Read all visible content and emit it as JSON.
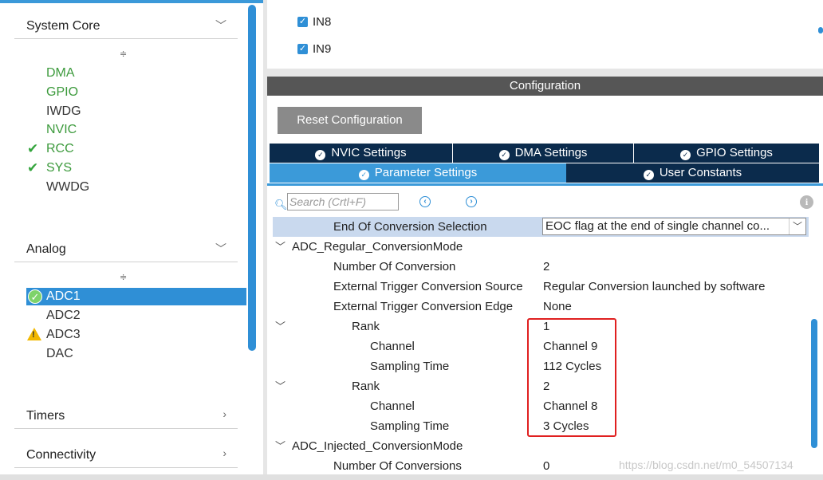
{
  "sidebar": {
    "categories": {
      "system_core": "System Core",
      "analog": "Analog",
      "timers": "Timers",
      "connectivity": "Connectivity"
    },
    "system_core_items": [
      "DMA",
      "GPIO",
      "IWDG",
      "NVIC",
      "RCC",
      "SYS",
      "WWDG"
    ],
    "analog_items": [
      "ADC1",
      "ADC2",
      "ADC3",
      "DAC"
    ]
  },
  "channels": {
    "in8": "IN8",
    "in9": "IN9"
  },
  "config": {
    "title": "Configuration",
    "reset_button": "Reset Configuration",
    "tabs": {
      "nvic": "NVIC Settings",
      "dma": "DMA Settings",
      "gpio": "GPIO Settings",
      "parameter": "Parameter Settings",
      "user_constants": "User Constants"
    },
    "search_placeholder": "Search (Crtl+F)",
    "params": {
      "eoc_label": "End Of Conversion Selection",
      "eoc_value": "EOC flag at the end of single channel co...",
      "regular_group": "ADC_Regular_ConversionMode",
      "num_conv_label": "Number Of Conversion",
      "num_conv_value": "2",
      "ext_trig_src_label": "External Trigger Conversion Source",
      "ext_trig_src_value": "Regular Conversion launched by software",
      "ext_trig_edge_label": "External Trigger Conversion Edge",
      "ext_trig_edge_value": "None",
      "rank1_label": "Rank",
      "rank1_value": "1",
      "rank1_channel_label": "Channel",
      "rank1_channel_value": "Channel 9",
      "rank1_sampling_label": "Sampling Time",
      "rank1_sampling_value": "112 Cycles",
      "rank2_label": "Rank",
      "rank2_value": "2",
      "rank2_channel_label": "Channel",
      "rank2_channel_value": "Channel 8",
      "rank2_sampling_label": "Sampling Time",
      "rank2_sampling_value": "3 Cycles",
      "injected_group": "ADC_Injected_ConversionMode",
      "num_inj_label": "Number Of Conversions",
      "num_inj_value": "0"
    }
  },
  "watermark": "https://blog.csdn.net/m0_54507134",
  "colors": {
    "accent": "#2f8fd6",
    "tab_dark": "#0b2b4c",
    "ok_green": "#3c9a3c",
    "warning": "#f2b800",
    "highlight_red": "#e02020"
  }
}
